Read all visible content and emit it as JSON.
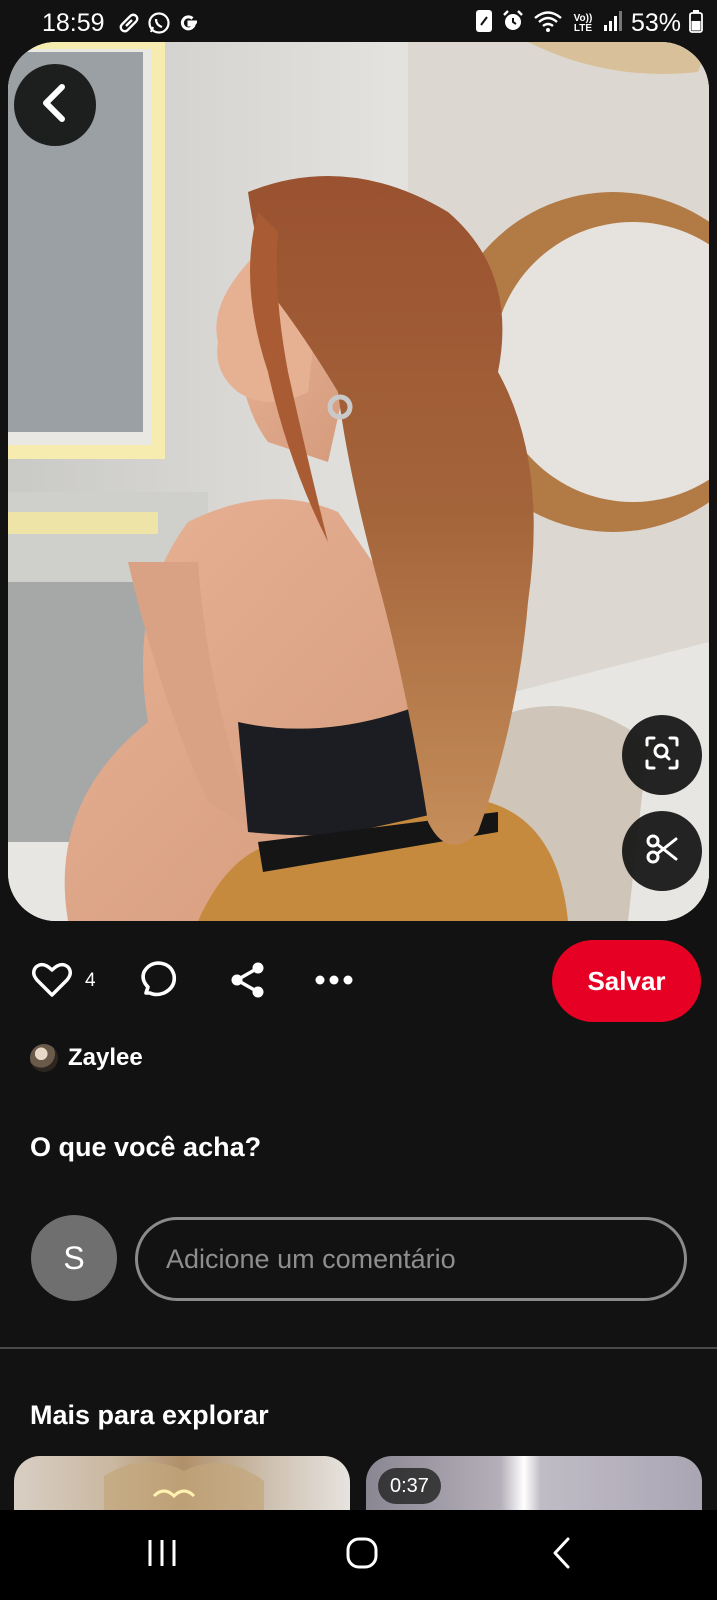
{
  "status_bar": {
    "time": "18:59",
    "battery": "53%",
    "left_icons": [
      "link-icon",
      "whatsapp-icon",
      "google-icon"
    ],
    "right_icons": [
      "nfc-icon",
      "alarm-icon",
      "wifi-icon",
      "volte-icon",
      "signal-icon",
      "battery-icon"
    ],
    "volte_label": "Vo)) LTE"
  },
  "pin": {
    "image_icon": "photo"
  },
  "actions": {
    "like_count": "4",
    "save_label": "Salvar"
  },
  "creator": {
    "name": "Zaylee"
  },
  "comments": {
    "title": "O que você acha?",
    "user_initial": "S",
    "input_placeholder": "Adicione um comentário"
  },
  "explore": {
    "title": "Mais para explorar",
    "cards": [
      {
        "duration": ""
      },
      {
        "duration": "0:37"
      }
    ]
  },
  "colors": {
    "background": "#121212",
    "save_button": "#e60023",
    "input_border": "#8a8a8a"
  }
}
